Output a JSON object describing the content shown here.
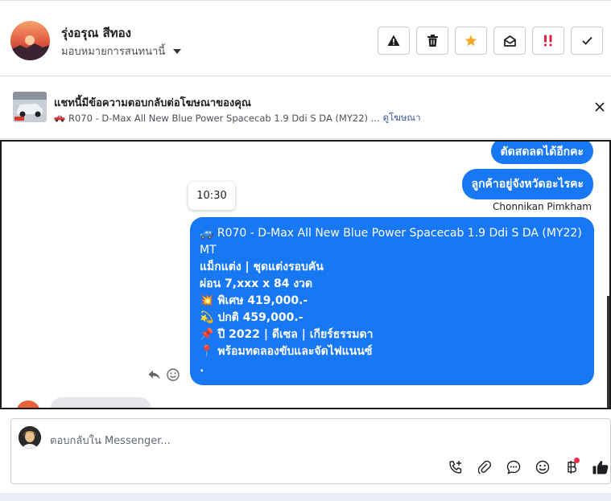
{
  "header": {
    "contact_name": "รุ่งอรุณ สีทอง",
    "assign_label": "มอบหมายการสนทนานี้",
    "actions": [
      {
        "name": "spam-warning-button",
        "icon": "warning-icon"
      },
      {
        "name": "delete-button",
        "icon": "trash-icon"
      },
      {
        "name": "star-button",
        "icon": "star-icon",
        "color": "#f5a623"
      },
      {
        "name": "mark-unread-button",
        "icon": "open-envelope-icon"
      },
      {
        "name": "follow-up-button",
        "icon": "double-exclamation-icon",
        "color": "#e41e3f"
      },
      {
        "name": "done-button",
        "icon": "checkmark-icon"
      }
    ]
  },
  "ad": {
    "title": "แชทนี้มีข้อความตอบกลับต่อโฆษณาของคุณ",
    "subtitle": "R070 - D-Max All New Blue Power Spacecab 1.9 Ddi S DA (MY22) ...",
    "view_ad_link": "ดูโฆษณา"
  },
  "chat": {
    "messages_out": [
      "ตัดสดลดได้อีกคะ",
      "ลูกค้าอยู่จังหวัดอะไรคะ"
    ],
    "sender_name": "Chonnikan Pimkham",
    "timestamp": "10:30",
    "ad_message": {
      "line1": "R070 - D-Max All New Blue Power Spacecab 1.9 Ddi S DA (MY22) MT",
      "line2": "แม็กแต่ง | ชุดแต่งรอบคัน",
      "line3": "ผ่อน 7,xxx x 84 งวด",
      "line4": "พิเศษ 419,000.-",
      "line5": "ปกติ 459,000.-",
      "line6": "ปี 2022 | ดีเซล | เกียร์ธรรมดา",
      "line7": "พร้อมทดลองขับและจัดไฟแนนซ์",
      "line8": "."
    }
  },
  "composer": {
    "placeholder": "ตอบกลับใน Messenger...",
    "icons": [
      "call-add-icon",
      "attachment-icon",
      "saved-reply-icon",
      "emoji-icon",
      "baht-payment-icon",
      "thumbs-up-icon"
    ]
  },
  "colors": {
    "brand_blue": "#1877f2",
    "link_blue": "#385898",
    "notification_red": "#f02849"
  }
}
